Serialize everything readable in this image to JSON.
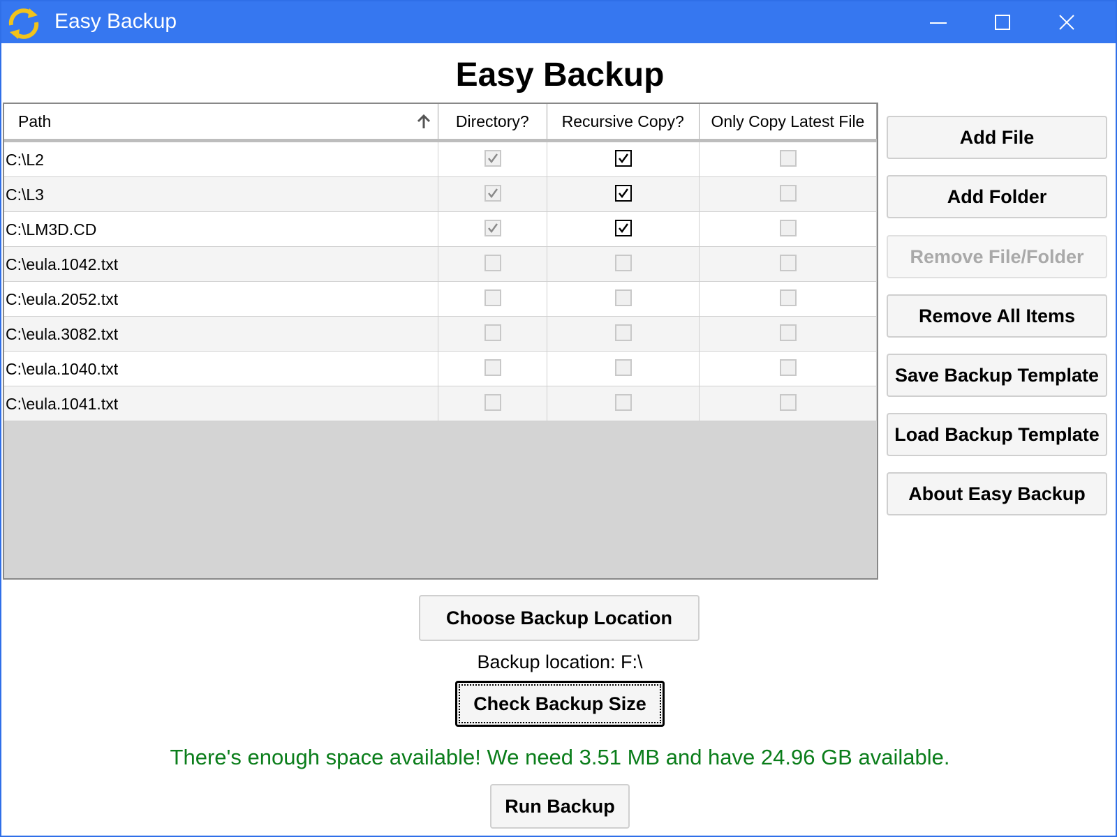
{
  "window": {
    "title": "Easy Backup",
    "accent_color": "#3677f0",
    "icon": "sync-arrows-icon"
  },
  "heading": "Easy Backup",
  "table": {
    "columns": {
      "path": "Path",
      "directory": "Directory?",
      "recursive": "Recursive Copy?",
      "latest": "Only Copy Latest File"
    },
    "sort": "path ascending",
    "rows": [
      {
        "path": "C:\\L2",
        "directory": true,
        "recursive": true,
        "latest": false
      },
      {
        "path": "C:\\L3",
        "directory": true,
        "recursive": true,
        "latest": false
      },
      {
        "path": "C:\\LM3D.CD",
        "directory": true,
        "recursive": true,
        "latest": false
      },
      {
        "path": "C:\\eula.1042.txt",
        "directory": false,
        "recursive": false,
        "latest": false
      },
      {
        "path": "C:\\eula.2052.txt",
        "directory": false,
        "recursive": false,
        "latest": false
      },
      {
        "path": "C:\\eula.3082.txt",
        "directory": false,
        "recursive": false,
        "latest": false
      },
      {
        "path": "C:\\eula.1040.txt",
        "directory": false,
        "recursive": false,
        "latest": false
      },
      {
        "path": "C:\\eula.1041.txt",
        "directory": false,
        "recursive": false,
        "latest": false
      }
    ]
  },
  "side_buttons": {
    "add_file": "Add File",
    "add_folder": "Add Folder",
    "remove": "Remove File/Folder",
    "remove_all": "Remove All Items",
    "save_template": "Save Backup Template",
    "load_template": "Load Backup Template",
    "about": "About Easy Backup"
  },
  "bottom": {
    "choose_location": "Choose Backup Location",
    "location_label": "Backup location: F:\\",
    "check_size": "Check Backup Size",
    "status_message": "There's enough space available! We need 3.51 MB and have 24.96 GB available.",
    "status_color": "#0a7d1a",
    "run_backup": "Run Backup"
  }
}
